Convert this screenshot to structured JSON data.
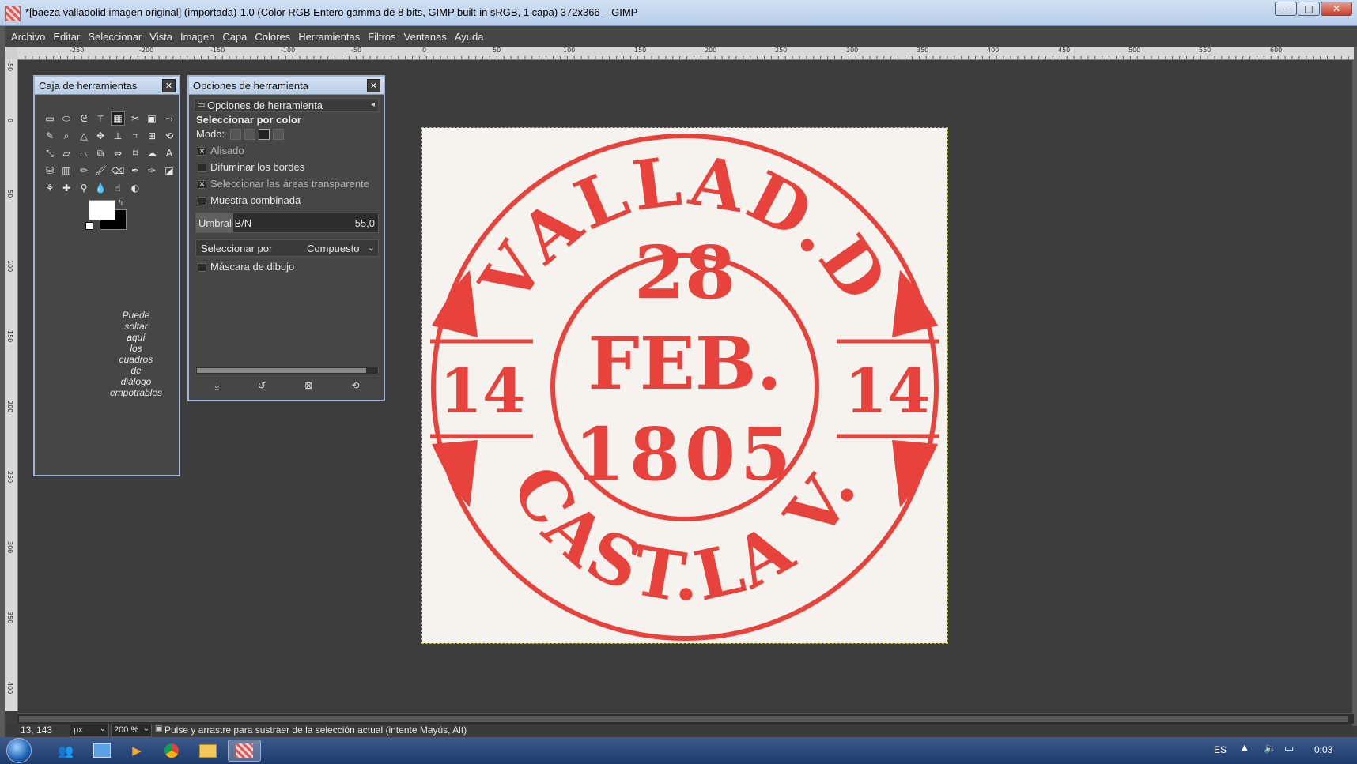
{
  "window": {
    "title": "*[baeza valladolid imagen original] (importada)-1.0 (Color RGB Entero gamma de 8 bits, GIMP built-in sRGB, 1 capa) 372x366 – GIMP",
    "minimize_label": "–",
    "maximize_label": "□",
    "close_label": "✕"
  },
  "menubar": [
    "Archivo",
    "Editar",
    "Seleccionar",
    "Vista",
    "Imagen",
    "Capa",
    "Colores",
    "Herramientas",
    "Filtros",
    "Ventanas",
    "Ayuda"
  ],
  "rulers": {
    "horizontal_labels": [
      "-250",
      "-200",
      "-150",
      "-100",
      "-50",
      "0",
      "50",
      "100",
      "150",
      "200",
      "250",
      "300",
      "350",
      "400",
      "450",
      "500",
      "550",
      "600"
    ],
    "vertical_labels": [
      "-50",
      "0",
      "50",
      "100",
      "150",
      "200",
      "250",
      "300",
      "350",
      "400"
    ]
  },
  "toolbox": {
    "title": "Caja de herramientas",
    "close_label": "✕",
    "drop_hint_lines": [
      "Puede",
      "soltar",
      "aquí",
      "los",
      "cuadros",
      "de",
      "diálogo",
      "empotrables"
    ]
  },
  "tool_options": {
    "window_title": "Opciones de herramienta",
    "tab_label": "Opciones de herramienta",
    "tool_name": "Seleccionar por color",
    "mode_label": "Modo:",
    "antialias_label": "Alisado",
    "feather_label": "Difuminar los bordes",
    "select_transparent_label": "Seleccionar las áreas transparente",
    "sample_merged_label": "Muestra combinada",
    "threshold_label": "Umbral B/N",
    "threshold_value": "55,0",
    "select_by_label": "Seleccionar por",
    "select_by_value": "Compuesto",
    "draw_mask_label": "Máscara de dibujo",
    "antialias_checked": true,
    "feather_checked": false,
    "select_transparent_checked": true,
    "sample_merged_checked": false,
    "draw_mask_checked": false
  },
  "stamp": {
    "top_text": "VALLAD.D",
    "bottom_text": "CAST.LA V.",
    "day": "28",
    "month": "FEB.",
    "year": "1805",
    "side_left": "14",
    "side_right": "14",
    "ink_color": "#e8423c"
  },
  "statusbar": {
    "coords": "13, 143",
    "unit": "px",
    "zoom": "200 %",
    "message": "Pulse y arrastre para sustraer de la selección actual (intente Mayús, Alt)"
  },
  "taskbar": {
    "language": "ES",
    "clock": "0:03"
  }
}
